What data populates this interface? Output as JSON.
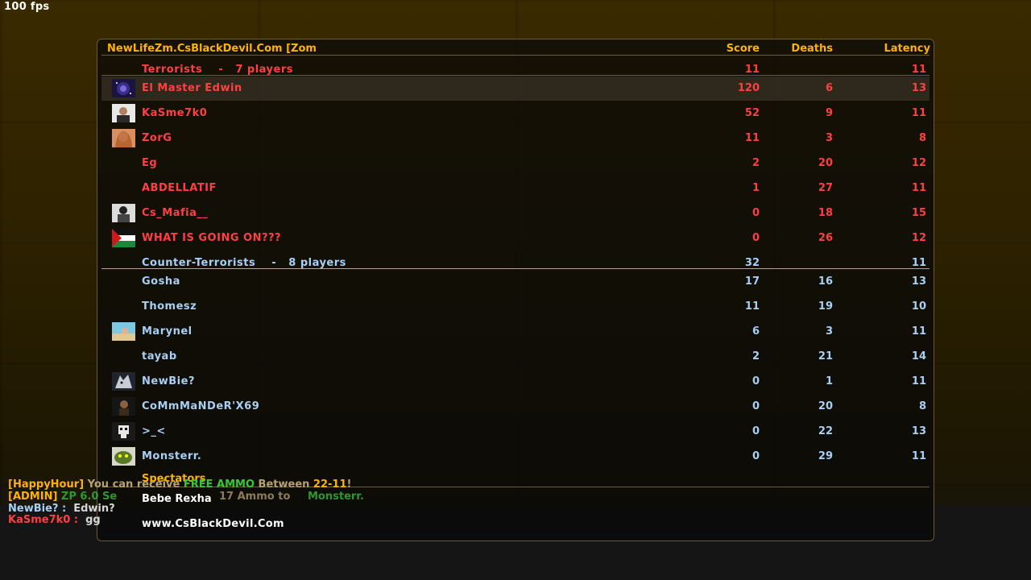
{
  "fps": "100 fps",
  "header": {
    "server": "NewLifeZm.CsBlackDevil.Com [Zom",
    "score": "Score",
    "deaths": "Deaths",
    "latency": "Latency"
  },
  "terrorists": {
    "label": "Terrorists    -   7 players",
    "score": "11",
    "latency": "11",
    "players": [
      {
        "name": "El Master Edwin",
        "score": "120",
        "deaths": "6",
        "latency": "13",
        "avatar": "galaxy-avatar"
      },
      {
        "name": "KaSme7k0",
        "score": "52",
        "deaths": "9",
        "latency": "11",
        "avatar": "portrait-avatar"
      },
      {
        "name": "ZorG",
        "score": "11",
        "deaths": "3",
        "latency": "8",
        "avatar": "girl-avatar"
      },
      {
        "name": "Eg",
        "score": "2",
        "deaths": "20",
        "latency": "12",
        "avatar": ""
      },
      {
        "name": "ABDELLATIF",
        "score": "1",
        "deaths": "27",
        "latency": "11",
        "avatar": ""
      },
      {
        "name": "Cs_Mafia__",
        "score": "0",
        "deaths": "18",
        "latency": "15",
        "avatar": "bw-portrait-avatar"
      },
      {
        "name": "WHAT IS GOING ON???",
        "score": "0",
        "deaths": "26",
        "latency": "12",
        "avatar": "flag-avatar"
      }
    ]
  },
  "cts": {
    "label": "Counter-Terrorists    -   8 players",
    "score": "32",
    "latency": "11",
    "players": [
      {
        "name": "Gosha",
        "score": "17",
        "deaths": "16",
        "latency": "13",
        "avatar": ""
      },
      {
        "name": "Thomesz",
        "score": "11",
        "deaths": "19",
        "latency": "10",
        "avatar": ""
      },
      {
        "name": "Marynel",
        "score": "6",
        "deaths": "3",
        "latency": "11",
        "avatar": "beach-avatar"
      },
      {
        "name": "tayab",
        "score": "2",
        "deaths": "21",
        "latency": "14",
        "avatar": ""
      },
      {
        "name": "NewBie?",
        "score": "0",
        "deaths": "1",
        "latency": "11",
        "avatar": "wolf-avatar"
      },
      {
        "name": "CoMmMaNDeR'X69",
        "score": "0",
        "deaths": "20",
        "latency": "8",
        "avatar": "soldier-avatar"
      },
      {
        "name": ">_<",
        "score": "0",
        "deaths": "22",
        "latency": "13",
        "avatar": "skull-avatar"
      },
      {
        "name": "Monsterr.",
        "score": "0",
        "deaths": "29",
        "latency": "11",
        "avatar": "monster-avatar"
      }
    ]
  },
  "spectators": {
    "title": "Spectators",
    "players": [
      "Bebe Rexha"
    ]
  },
  "footer_site": "www.CsBlackDevil.Com",
  "chat": {
    "line1": {
      "tag": "[HappyHour]",
      "a": " You can receive ",
      "b": "FREE AMMO",
      "c": " Between ",
      "d": "22-11",
      "e": "!"
    },
    "line2": {
      "tag": "[ADMIN]",
      "a": " ZP 6.0 Se",
      "b": "17 Ammo to ",
      "c": "Monsterr."
    },
    "line3": {
      "name": "NewBie? :",
      "msg": "  Edwin?"
    },
    "line4": {
      "name": "KaSme7k0 :",
      "msg": "  gg"
    }
  },
  "colors": {
    "terrorist": "#ff4040",
    "ct": "#a8d0f5",
    "header": "#ffb300"
  }
}
